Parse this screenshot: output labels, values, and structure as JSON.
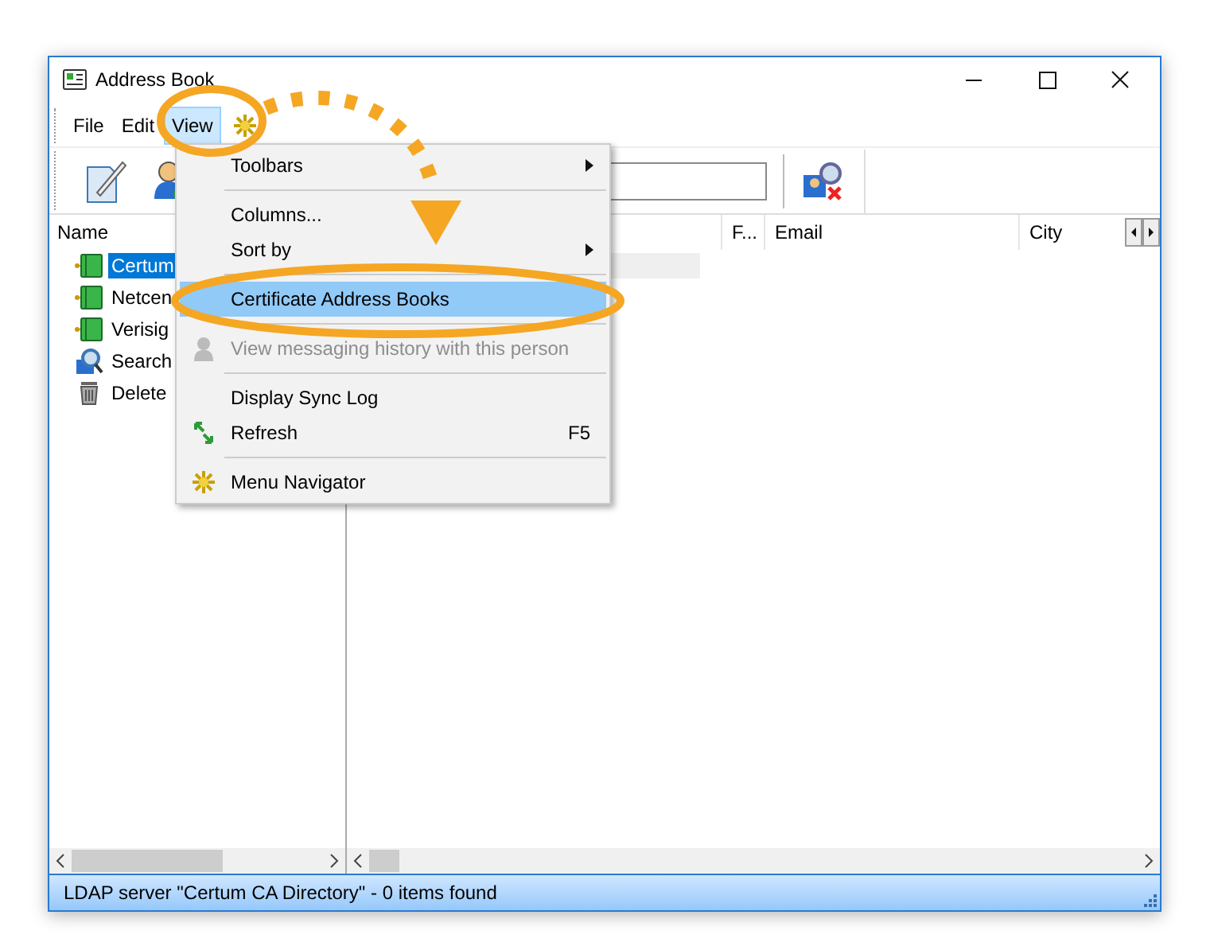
{
  "window": {
    "title": "Address Book"
  },
  "menu_bar": [
    {
      "label": "File",
      "selected": false
    },
    {
      "label": "Edit",
      "selected": false
    },
    {
      "label": "View",
      "selected": true
    }
  ],
  "tree": [
    {
      "label": "Certum",
      "kind": "book",
      "selected": true
    },
    {
      "label": "Netcen",
      "kind": "book",
      "selected": false
    },
    {
      "label": "Verisig",
      "kind": "book",
      "selected": false
    },
    {
      "label": "Search",
      "kind": "search",
      "selected": false
    },
    {
      "label": "Delete",
      "kind": "trash",
      "selected": false
    }
  ],
  "left_columns": [
    "Name"
  ],
  "columns": [
    "F...",
    "Email",
    "City"
  ],
  "menu": [
    {
      "kind": "item",
      "label": "Toolbars",
      "submenu": true,
      "selected": false,
      "disabled": false
    },
    {
      "kind": "separator"
    },
    {
      "kind": "item",
      "label": "Columns...",
      "submenu": false,
      "selected": false,
      "disabled": false
    },
    {
      "kind": "item",
      "label": "Sort by",
      "submenu": true,
      "selected": false,
      "disabled": false
    },
    {
      "kind": "separator"
    },
    {
      "kind": "item",
      "label": "Certificate Address Books",
      "submenu": false,
      "selected": true,
      "disabled": false
    },
    {
      "kind": "separator"
    },
    {
      "kind": "person",
      "label": "View messaging history with this person",
      "submenu": false,
      "selected": false,
      "disabled": true
    },
    {
      "kind": "separator"
    },
    {
      "kind": "item",
      "label": "Display Sync Log",
      "submenu": false,
      "selected": false,
      "disabled": false
    },
    {
      "kind": "refresh",
      "label": "Refresh",
      "shortcut": "F5",
      "submenu": false,
      "selected": false,
      "disabled": false
    },
    {
      "kind": "separator"
    },
    {
      "kind": "gear",
      "label": "Menu Navigator",
      "submenu": false,
      "selected": false,
      "disabled": false
    }
  ],
  "status_bar": "LDAP server \"Certum CA Directory\" - 0 items found"
}
